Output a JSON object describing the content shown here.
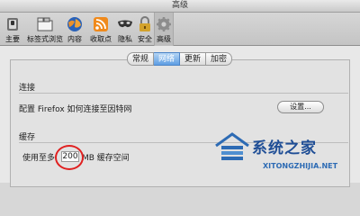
{
  "window": {
    "title": "高级"
  },
  "toolbar": {
    "items": [
      {
        "label": "主要",
        "icon": "switch-icon"
      },
      {
        "label": "标签式浏览",
        "icon": "tabs-icon"
      },
      {
        "label": "内容",
        "icon": "globe-icon"
      },
      {
        "label": "收取点",
        "icon": "rss-feed-icon"
      },
      {
        "label": "隐私",
        "icon": "mask-icon"
      },
      {
        "label": "安全",
        "icon": "lock-icon"
      },
      {
        "label": "高级",
        "icon": "gear-icon",
        "selected": true
      }
    ]
  },
  "tabs": [
    {
      "label": "常规",
      "active": false
    },
    {
      "label": "网络",
      "active": true
    },
    {
      "label": "更新",
      "active": false
    },
    {
      "label": "加密",
      "active": false
    }
  ],
  "connection": {
    "title": "连接",
    "description": "配置 Firefox 如何连接至因特网",
    "settings_button": "设置..."
  },
  "cache": {
    "title": "缓存",
    "prefix": "使用至多",
    "value": "200",
    "suffix": "MB 缓存空间"
  },
  "watermark": {
    "main": "系统之家",
    "sub": "XITONGZHIJIA.NET"
  },
  "colors": {
    "accent": "#5e9ee3",
    "highlight": "#e02020",
    "watermark": "#1f4e96"
  }
}
